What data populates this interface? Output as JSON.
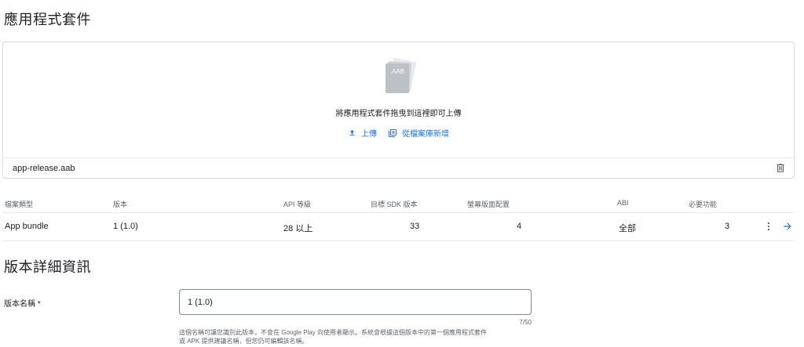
{
  "sections": {
    "bundles_title": "應用程式套件",
    "release_details_title": "版本詳細資訊"
  },
  "upload": {
    "file_badge": ".AAB",
    "drop_text": "將應用程式套件拖曳到這裡即可上傳",
    "upload_label": "上傳",
    "library_label": "從檔案庫新增",
    "file_name": "app-release.aab",
    "icons": {
      "upload": "upload-icon",
      "library": "add-to-library-icon",
      "delete": "trash-icon"
    }
  },
  "table": {
    "headers": {
      "type": "檔案類型",
      "version": "版本",
      "api": "API 等級",
      "sdk": "目標 SDK 版本",
      "screen": "螢幕版面配置",
      "abi": "ABI",
      "features": "必要功能"
    },
    "rows": [
      {
        "type": "App bundle",
        "version": "1 (1.0)",
        "api": "28 以上",
        "sdk": "33",
        "screen": "4",
        "abi": "全部",
        "features": "3"
      }
    ],
    "row_icons": [
      "more-vert-icon",
      "arrow-right-icon"
    ]
  },
  "form": {
    "release_name_label": "版本名稱 *",
    "release_name_value": "1 (1.0)",
    "counter": "7/50",
    "helper_line1": "這個名稱可讓您識別此版本，不會在 Google Play 向使用者顯示。系統會根據這個版本中的第一個應用程式套件",
    "helper_line2": "或 APK 提供建議名稱，但您仍可編輯該名稱。"
  },
  "colors": {
    "accent": "#1a73e8",
    "border": "#dadce0",
    "muted_text": "#5f6368"
  }
}
